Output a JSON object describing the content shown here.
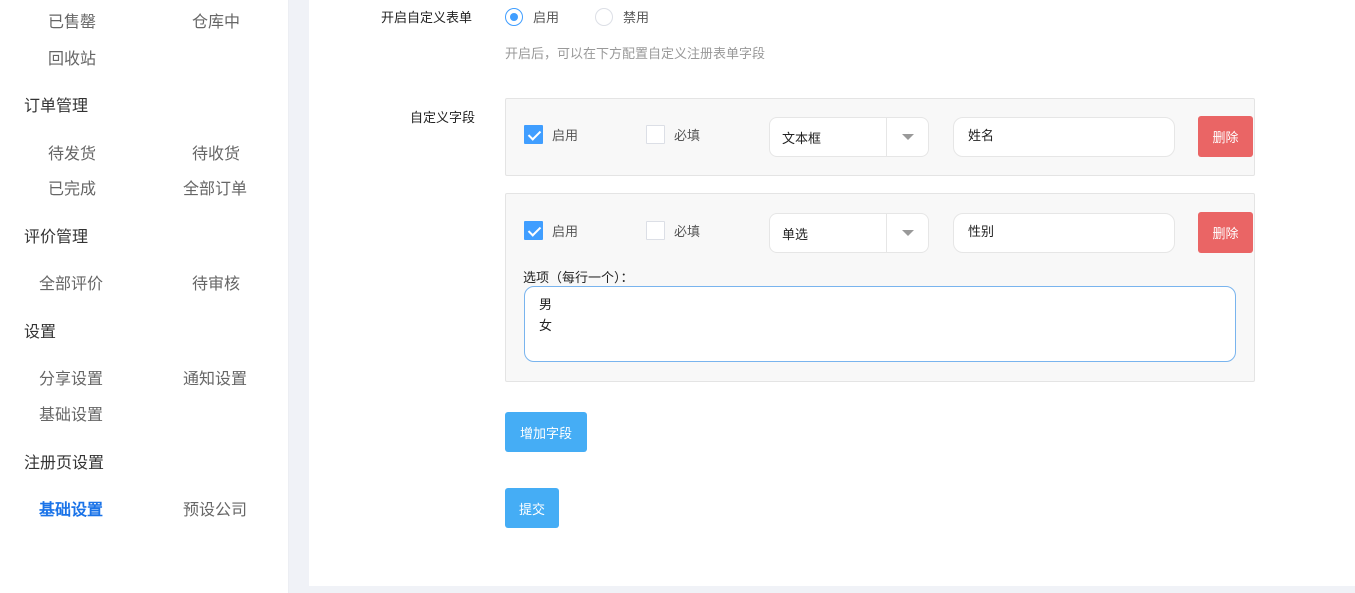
{
  "sidebar": {
    "row1": [
      "已售罄",
      "仓库中"
    ],
    "recycle": "回收站",
    "order_group": "订单管理",
    "order_items": [
      "待发货",
      "待收货",
      "已完成",
      "全部订单"
    ],
    "review_group": "评价管理",
    "review_items": [
      "全部评价",
      "待审核"
    ],
    "settings_group": "设置",
    "settings_items": [
      "分享设置",
      "通知设置",
      "基础设置"
    ],
    "register_group": "注册页设置",
    "register_items": [
      "基础设置",
      "预设公司"
    ]
  },
  "form": {
    "custom_form_label": "开启自定义表单",
    "enable_label": "启用",
    "disable_label": "禁用",
    "hint": "开启后，可以在下方配置自定义注册表单字段",
    "custom_fields_label": "自定义字段",
    "fields": [
      {
        "enabled_label": "启用",
        "required_label": "必填",
        "type": "文本框",
        "name": "姓名",
        "delete_label": "删除"
      },
      {
        "enabled_label": "启用",
        "required_label": "必填",
        "type": "单选",
        "name": "性别",
        "delete_label": "删除",
        "options_label": "选项（每行一个）：",
        "options_text": "男\n女"
      }
    ],
    "add_field_label": "增加字段",
    "submit_label": "提交"
  },
  "colors": {
    "accent": "#409eff",
    "primary_button": "#45adf5",
    "danger_button": "#ea6565",
    "active_nav": "#1a73e8"
  }
}
